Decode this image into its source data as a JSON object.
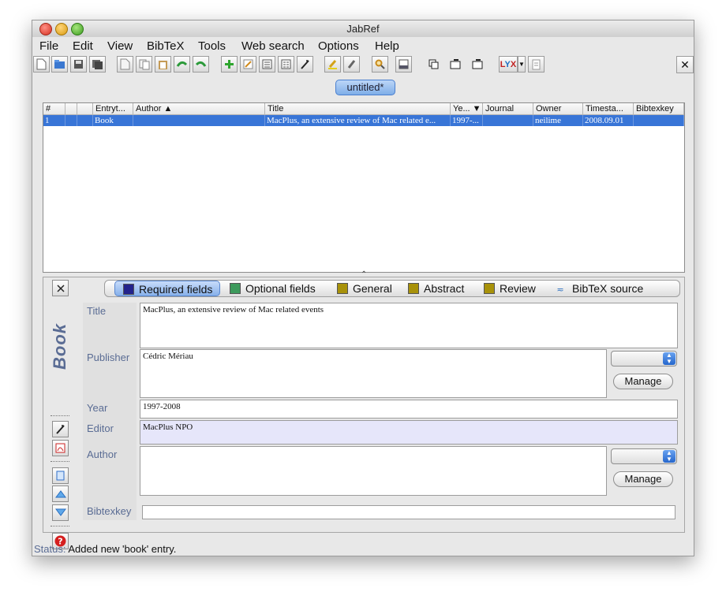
{
  "window": {
    "title": "JabRef"
  },
  "menu": [
    "File",
    "Edit",
    "View",
    "BibTeX",
    "Tools",
    "Web search",
    "Options",
    "Help"
  ],
  "toolbar_icons": [
    "new-file-icon",
    "open-icon",
    "save-icon",
    "save-all-icon",
    "cut-icon",
    "copy-icon",
    "paste-icon",
    "undo-icon",
    "redo-icon",
    "add-entry-icon",
    "edit-entry-icon",
    "preamble-icon",
    "strings-icon",
    "wand-icon",
    "highlight-icon",
    "clear-icon",
    "search-icon",
    "preview-icon",
    "duplicate-icon",
    "push-left-icon",
    "push-right-icon",
    "lyx-icon",
    "lyx-dropdown-icon",
    "export-icon"
  ],
  "document_tab": "untitled*",
  "table": {
    "headers": [
      "#",
      "",
      "",
      "Entryt...",
      "Author ▲",
      "Title",
      "Ye... ▼",
      "Journal",
      "Owner",
      "Timesta...",
      "Bibtexkey"
    ],
    "rows": [
      [
        "1",
        "",
        "",
        "Book",
        "",
        "MacPlus, an extensive review of Mac related e...",
        "1997-...",
        "",
        "neilime",
        "2008.09.01",
        ""
      ]
    ]
  },
  "editor": {
    "entry_type": "Book",
    "tabs": [
      {
        "label": "Required fields",
        "color": "#23238c"
      },
      {
        "label": "Optional fields",
        "color": "#3d9a5c"
      },
      {
        "label": "General",
        "color": "#a8920a"
      },
      {
        "label": "Abstract",
        "color": "#a8920a"
      },
      {
        "label": "Review",
        "color": "#a8920a"
      },
      {
        "label": "BibTeX source",
        "color": ""
      }
    ],
    "fields": {
      "title": {
        "label": "Title",
        "value": "MacPlus, an extensive review of Mac related events"
      },
      "publisher": {
        "label": "Publisher",
        "value": "Cédric Mériau",
        "button": "Manage"
      },
      "year": {
        "label": "Year",
        "value": "1997-2008"
      },
      "editor": {
        "label": "Editor",
        "value": "MacPlus NPO"
      },
      "author": {
        "label": "Author",
        "value": "",
        "button": "Manage"
      },
      "bibtexkey": {
        "label": "Bibtexkey",
        "value": ""
      }
    }
  },
  "status": {
    "label": "Status:",
    "text": "Added new 'book' entry."
  }
}
